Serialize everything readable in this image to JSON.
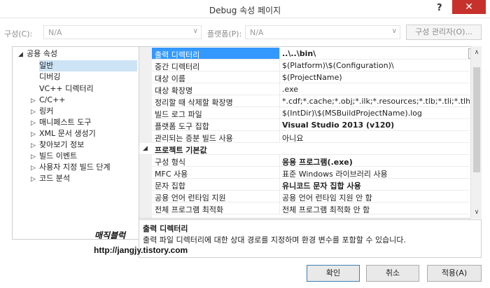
{
  "window": {
    "title": "Debug 속성 페이지",
    "help": "?",
    "close": "✕"
  },
  "config_bar": {
    "config_label": "구성(C):",
    "config_value": "N/A",
    "platform_label": "플랫폼(P):",
    "platform_value": "N/A",
    "dropdown_glyph": "∨",
    "manager_button": "구성 관리자(O)..."
  },
  "tree": {
    "items": [
      {
        "label": "공용 속성",
        "twisty": "◢",
        "selected": false
      },
      {
        "label": "일반",
        "twisty": "",
        "selected": true
      },
      {
        "label": "디버깅",
        "twisty": "",
        "selected": false
      },
      {
        "label": "VC++ 디렉터리",
        "twisty": "",
        "selected": false
      },
      {
        "label": "C/C++",
        "twisty": "▷",
        "selected": false
      },
      {
        "label": "링커",
        "twisty": "▷",
        "selected": false
      },
      {
        "label": "매니페스트 도구",
        "twisty": "▷",
        "selected": false
      },
      {
        "label": "XML 문서 생성기",
        "twisty": "▷",
        "selected": false
      },
      {
        "label": "찾아보기 정보",
        "twisty": "▷",
        "selected": false
      },
      {
        "label": "빌드 이벤트",
        "twisty": "▷",
        "selected": false
      },
      {
        "label": "사용자 지정 빌드 단계",
        "twisty": "▷",
        "selected": false
      },
      {
        "label": "코드 분석",
        "twisty": "▷",
        "selected": false
      }
    ]
  },
  "grid": {
    "dropdown_glyph": "∨",
    "rows": [
      {
        "name": "출력 디렉터리",
        "value": "..\\..\\bin\\",
        "bold": true,
        "highlight": true,
        "category": false
      },
      {
        "name": "중간 디렉터리",
        "value": "$(Platform)\\$(Configuration)\\",
        "bold": false,
        "highlight": false,
        "category": false
      },
      {
        "name": "대상 이름",
        "value": "$(ProjectName)",
        "bold": false,
        "highlight": false,
        "category": false
      },
      {
        "name": "대상 확장명",
        "value": ".exe",
        "bold": false,
        "highlight": false,
        "category": false
      },
      {
        "name": "정리할 때 삭제할 확장명",
        "value": "*.cdf;*.cache;*.obj;*.ilk;*.resources;*.tlb;*.tli;*.tlh;*.tmp;*.",
        "bold": false,
        "highlight": false,
        "category": false
      },
      {
        "name": "빌드 로그 파일",
        "value": "$(IntDir)\\$(MSBuildProjectName).log",
        "bold": false,
        "highlight": false,
        "category": false
      },
      {
        "name": "플랫폼 도구 집합",
        "value": "Visual Studio 2013 (v120)",
        "bold": true,
        "highlight": false,
        "category": false
      },
      {
        "name": "관리되는 증분 빌드 사용",
        "value": "아니요",
        "bold": false,
        "highlight": false,
        "category": false
      },
      {
        "name": "프로젝트 기본값",
        "value": "",
        "bold": false,
        "highlight": false,
        "category": true
      },
      {
        "name": "구성 형식",
        "value": "응용 프로그램(.exe)",
        "bold": true,
        "highlight": false,
        "category": false
      },
      {
        "name": "MFC 사용",
        "value": "표준 Windows 라이브러리 사용",
        "bold": false,
        "highlight": false,
        "category": false
      },
      {
        "name": "문자 집합",
        "value": "유니코드 문자 집합 사용",
        "bold": true,
        "highlight": false,
        "category": false
      },
      {
        "name": "공용 언어 런타임 지원",
        "value": "공용 언어 런타임 지원 안 함",
        "bold": false,
        "highlight": false,
        "category": false
      },
      {
        "name": "전체 프로그램 최적화",
        "value": "전체 프로그램 최적화 안 함",
        "bold": false,
        "highlight": false,
        "category": false
      }
    ]
  },
  "scrollbar": {
    "up": "∧",
    "down": "∨"
  },
  "description": {
    "title": "출력 디렉터리",
    "text": "출력 파일 디렉터리에 대한 상대 경로를 지정하며 환경 변수를 포함할 수 있습니다."
  },
  "overlay": {
    "watermark": "매직블럭",
    "url": "http://jangjy.tistory.com"
  },
  "buttons": {
    "ok": "확인",
    "cancel": "취소",
    "apply": "적용(A)"
  }
}
